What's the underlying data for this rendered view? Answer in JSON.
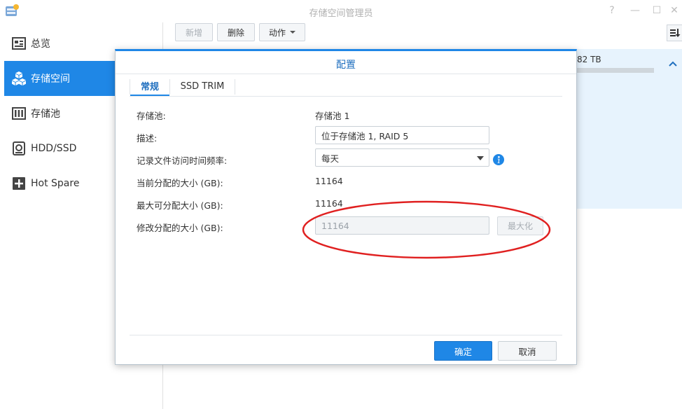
{
  "window": {
    "title": "存储空间管理员",
    "controls": {
      "help": "?",
      "minimize": "—",
      "maximize": "☐",
      "close": "✕"
    }
  },
  "sidebar": {
    "items": [
      {
        "label": "总览",
        "icon": "overview-icon",
        "active": false
      },
      {
        "label": "存储空间",
        "icon": "volume-cubes-icon",
        "active": true
      },
      {
        "label": "存储池",
        "icon": "storage-pool-icon",
        "active": false
      },
      {
        "label": "HDD/SSD",
        "icon": "hdd-icon",
        "active": false
      },
      {
        "label": "Hot Spare",
        "icon": "hot-spare-icon",
        "active": false
      }
    ]
  },
  "toolbar": {
    "create_label": "新增",
    "delete_label": "删除",
    "action_label": "动作"
  },
  "background": {
    "size_text": "82 TB"
  },
  "dialog": {
    "title": "配置",
    "tabs": [
      {
        "label": "常规",
        "active": true
      },
      {
        "label": "SSD TRIM",
        "active": false
      }
    ],
    "fields": {
      "pool": {
        "label": "存储池:",
        "value": "存储池 1"
      },
      "description": {
        "label": "描述:",
        "value": "位于存储池 1, RAID 5"
      },
      "access_freq": {
        "label": "记录文件访问时间频率:",
        "value": "每天"
      },
      "current_size": {
        "label": "当前分配的大小 (GB):",
        "value": "11164"
      },
      "max_size": {
        "label": "最大可分配大小 (GB):",
        "value": "11164"
      },
      "modify_size": {
        "label": "修改分配的大小 (GB):",
        "value": "11164"
      }
    },
    "maximize_label": "最大化",
    "ok_label": "确定",
    "cancel_label": "取消"
  },
  "colors": {
    "accent": "#1f87e6",
    "selection_bg": "#e7f3fd",
    "annotation": "#e02020"
  }
}
